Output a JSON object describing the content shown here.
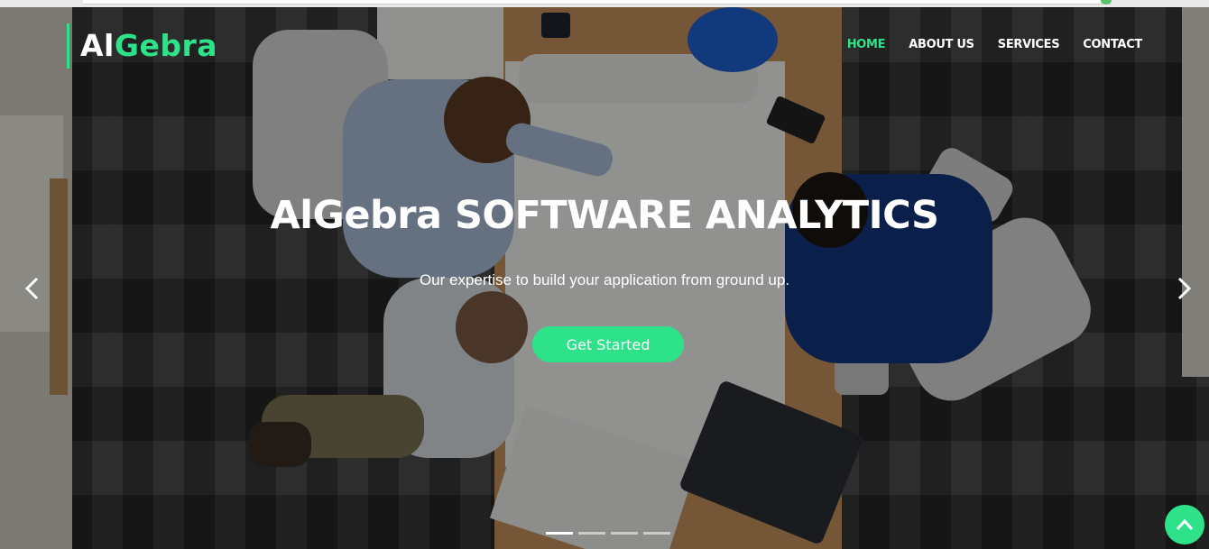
{
  "brand": {
    "part1": "Al",
    "part2": "Gebra"
  },
  "nav": {
    "items": [
      {
        "label": "HOME",
        "active": true
      },
      {
        "label": "ABOUT US",
        "active": false
      },
      {
        "label": "SERVICES",
        "active": false
      },
      {
        "label": "CONTACT",
        "active": false
      }
    ]
  },
  "hero": {
    "title": "AlGebra SOFTWARE ANALYTICS",
    "subtitle": "Our expertise to build your application from ground up.",
    "cta_label": "Get Started"
  },
  "carousel": {
    "prev_icon": "chevron-left-icon",
    "next_icon": "chevron-right-icon",
    "slide_count": 4,
    "active_slide": 1
  },
  "back_to_top_icon": "chevron-up-icon",
  "colors": {
    "accent": "#2ee28a",
    "text": "#ffffff"
  }
}
